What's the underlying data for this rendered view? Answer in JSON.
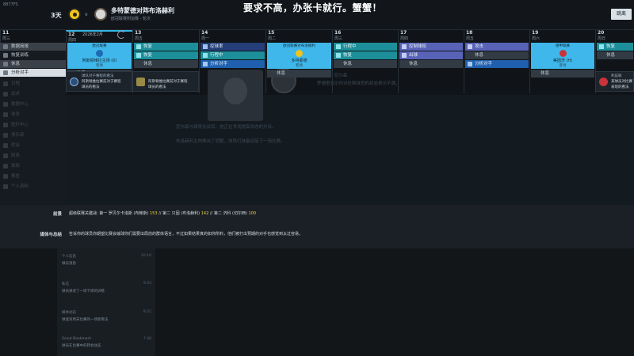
{
  "topbar": {
    "corner_tag": "8877FS",
    "days_left": "3天",
    "vs": "v",
    "match_title": "多特蒙德对阵布洛赫利",
    "match_sub": "欧冠联赛附加赛 - 轮次",
    "headline": "要求不高，办张卡就行。蟹蟹！",
    "skip_label": "跳离"
  },
  "date_range": "2026年2月",
  "days": [
    {
      "num": "11",
      "wk": "周三"
    },
    {
      "num": "12",
      "wk": "周四"
    },
    {
      "num": "13",
      "wk": "周五"
    },
    {
      "num": "14",
      "wk": "周一"
    },
    {
      "num": "15",
      "wk": "周二"
    },
    {
      "num": "16",
      "wk": "周三"
    },
    {
      "num": "17",
      "wk": "周四"
    },
    {
      "num": "18",
      "wk": "周五"
    },
    {
      "num": "19",
      "wk": "周六"
    },
    {
      "num": "20",
      "wk": "周日"
    }
  ],
  "sidebar": {
    "items": [
      {
        "label": "数据简报"
      },
      {
        "label": "恢复训练"
      },
      {
        "label": "休息"
      },
      {
        "label": "分析对手"
      },
      {
        "label": "日程"
      },
      {
        "label": "战术"
      },
      {
        "label": "数据中心"
      },
      {
        "label": "球员"
      },
      {
        "label": "医疗中心"
      },
      {
        "label": "俱乐部"
      },
      {
        "label": "转会"
      },
      {
        "label": "财务"
      },
      {
        "label": "球探"
      },
      {
        "label": "报告"
      },
      {
        "label": "个人资料"
      }
    ]
  },
  "columns": {
    "c12": {
      "card_top": "欧冠联赛",
      "card_line": "阿斯顿维拉主场 (0)",
      "card_sub": "客场",
      "cell": "休息"
    },
    "c13": {
      "cells": [
        "恢复",
        "恢复",
        "休息"
      ]
    },
    "c14": {
      "cells": [
        "控球率",
        "行程中",
        "分析对手"
      ]
    },
    "c15": {
      "card_top": "欧冠联赛对布洛赫利",
      "card_line": "多特蒙德",
      "card_sub": "客场",
      "cell": "休息"
    },
    "c16": {
      "cells": [
        "行程中",
        "恢复",
        "休息"
      ]
    },
    "c17": {
      "cells": [
        "控制球权",
        "出球",
        "休息"
      ]
    },
    "c18": {
      "cells": [
        "攻击",
        "休息",
        "分析对手"
      ]
    },
    "c19": {
      "card_top": "德甲联赛",
      "card_line": "美因茨 (H)",
      "card_sub": "客场",
      "cell": "休息"
    },
    "c20": {
      "cells": [
        "恢复",
        "休息"
      ]
    }
  },
  "info_cards": [
    {
      "t1": "球队对于赛程的看法",
      "t2": "阿斯顿维拉赛前对于赛程",
      "t3": "球员的看法"
    },
    {
      "t1": "",
      "t2": "阿斯顿维拉赛前对于赛程",
      "t3": "球员的看法"
    },
    {
      "t1": "利兹联",
      "t2": "某球员对比赛",
      "t3": "表现的看法"
    }
  ],
  "news": {
    "author": "罗德里 · 尼尔森",
    "line1": "罗德里表示你对伦斯球员的状态表示不满。",
    "line2": "尼尔森与球员交谈后，他正在寻找提高状态的方法。",
    "line3": "布洛赫利主帅做出了调整，球员们准备迎接下一场比赛。"
  },
  "bottom": {
    "label1": "前景",
    "text1_a": "超级联赛关键战: 第一 罗贝尔卡洛斯 (布赖斯)",
    "text1_b": "153",
    "text1_c": "// 第二 只因 (布洛赫利)",
    "text1_d": "142",
    "text1_e": "// 第二 济科 (切尔西)",
    "text1_f": "100",
    "label2": "媒体与总结",
    "text2": "告诉你的球员你期望比赛会输球你们需要出局前的群体语言，不过如果结果真的如你所料，他们被打出预期的对手也感觉到太过容易。"
  },
  "feed": [
    {
      "title": "个人信息",
      "body": "球员消息",
      "time": "10:16"
    },
    {
      "title": "私信",
      "body": "球员讲述了一场下周的训练",
      "time": "9:03"
    },
    {
      "title": "媒体动态",
      "body": "球迷对周末比赛的一场新看法",
      "time": "8:22"
    },
    {
      "title": "Scout Bookmark",
      "body": "球员在比赛中的转会动态",
      "time": "7:48"
    }
  ],
  "colors": {
    "match_card": "#3fb7ea",
    "cell_blue": "#1f5fae",
    "cell_teal": "#1c8f9a",
    "cell_purple": "#5863b7",
    "highlight_number": "#f0d341"
  }
}
